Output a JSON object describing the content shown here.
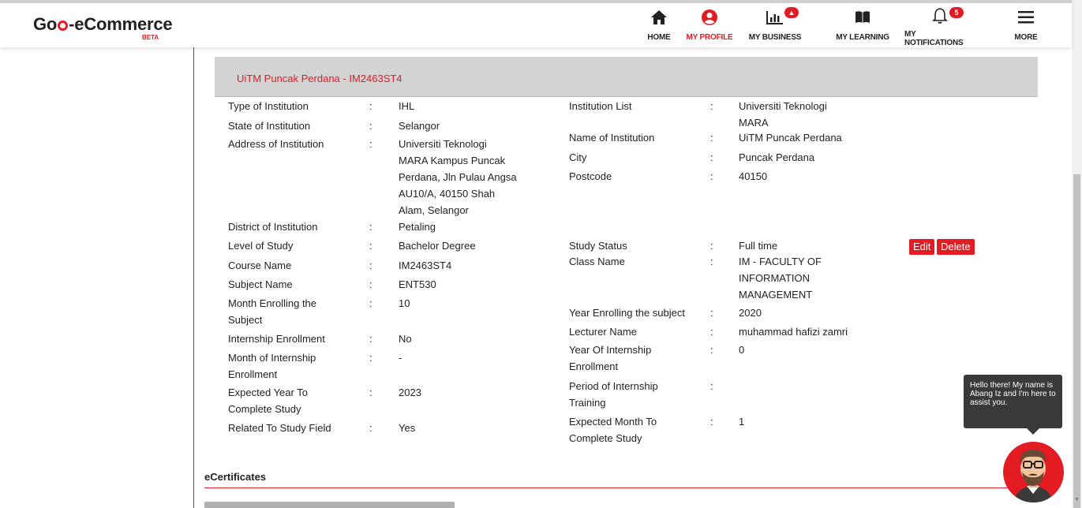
{
  "app": {
    "logo": "Go-eCommerce",
    "logo_beta": "BETA"
  },
  "nav": [
    {
      "label": "HOME",
      "icon": "home-icon"
    },
    {
      "label": "MY PROFILE",
      "icon": "user-icon",
      "active": true
    },
    {
      "label": "MY BUSINESS",
      "icon": "chart-icon"
    },
    {
      "label": "MY LEARNING",
      "icon": "book-icon"
    },
    {
      "label": "MY NOTIFICATIONS",
      "icon": "bell-icon",
      "badge": "5"
    },
    {
      "label": "MORE",
      "icon": "menu-icon"
    }
  ],
  "record": {
    "title": "UiTM Puncak Perdana - IM2463ST4",
    "colon": ":",
    "left": [
      {
        "label": "Type of Institution",
        "value": "IHL"
      },
      {
        "label": "State of Institution",
        "value": "Selangor"
      },
      {
        "label": "Address of Institution",
        "value": "Universiti Teknologi MARA Kampus Puncak Perdana, Jln Pulau Angsa AU10/A, 40150 Shah Alam, Selangor"
      },
      {
        "label": "District of Institution",
        "value": "Petaling"
      },
      {
        "label": "Level of Study",
        "value": "Bachelor Degree"
      },
      {
        "label": "Course Name",
        "value": "IM2463ST4"
      },
      {
        "label": "Subject Name",
        "value": "ENT530"
      },
      {
        "label": "Month Enrolling the Subject",
        "value": "10"
      },
      {
        "label": "Internship Enrollment",
        "value": "No"
      },
      {
        "label": "Month of Internship Enrollment",
        "value": "-"
      },
      {
        "label": "Expected Year To Complete Study",
        "value": "2023"
      },
      {
        "label": "Related To Study Field",
        "value": "Yes"
      }
    ],
    "right": [
      {
        "label": "Institution List",
        "value": "Universiti Teknologi MARA"
      },
      {
        "label": "Name of Institution",
        "value": "UiTM Puncak Perdana"
      },
      {
        "label": "City",
        "value": "Puncak Perdana"
      },
      {
        "label": "Postcode",
        "value": "40150"
      },
      {
        "label": "Study Status",
        "value": "Full time"
      },
      {
        "label": "Class Name",
        "value": "IM - FACULTY OF INFORMATION MANAGEMENT"
      },
      {
        "label": "Year Enrolling the subject",
        "value": "2020"
      },
      {
        "label": "Lecturer Name",
        "value": "muhammad hafizi zamri"
      },
      {
        "label": "Year Of Internship Enrollment",
        "value": "0"
      },
      {
        "label": "Period of Internship Training",
        "value": ""
      },
      {
        "label": "Expected Month To Complete Study",
        "value": "1"
      }
    ],
    "edit_label": "Edit",
    "delete_label": "Delete"
  },
  "ecertificates": {
    "title": "eCertificates"
  },
  "chat": {
    "message": "Hello there! My name is Abang Iz and I'm here to assist you."
  },
  "colors": {
    "accent": "#e31b23",
    "header_bar": "#d3d3d3",
    "chat_bubble": "#3a3a3a"
  }
}
